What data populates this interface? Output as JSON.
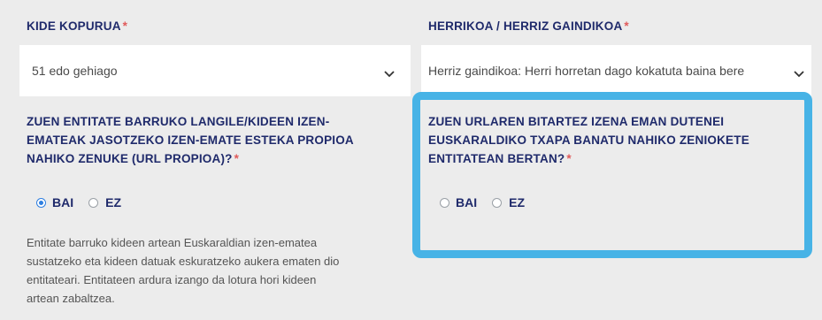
{
  "left": {
    "field_label": "KIDE KOPURUA",
    "required_mark": "*",
    "select_value": "51 edo gehiago",
    "question": [
      "ZUEN ENTITATE BARRUKO LANGILE/KIDEEN IZEN-",
      "EMATEAK JASOTZEKO IZEN-EMATE ESTEKA PROPIOA",
      "NAHIKO ZENUKE (URL PROPIOA)?"
    ],
    "option_yes": "BAI",
    "option_no": "EZ",
    "selected": "BAI",
    "help_lines": [
      "Entitate barruko kideen artean Euskaraldian izen-ematea",
      "sustatzeko eta kideen datuak eskuratzeko aukera ematen dio",
      "entitateari. Entitateen ardura izango da lotura hori kideen",
      "artean zabaltzea."
    ]
  },
  "right": {
    "field_label": "HERRIKOA / HERRIZ GAINDIKOA",
    "required_mark": "*",
    "select_value": "Herriz gaindikoa: Herri horretan dago kokatuta baina bere",
    "question": [
      "ZUEN URLAREN BITARTEZ IZENA EMAN DUTENEI",
      "EUSKARALDIKO TXAPA BANATU NAHIKO ZENIOKETE",
      "ENTITATEAN BERTAN?"
    ],
    "option_yes": "BAI",
    "option_no": "EZ",
    "selected": null
  },
  "colors": {
    "highlight_border": "#47b3e6",
    "label": "#1f2a6b",
    "required": "#e05a5a",
    "radio_selected": "#2f7fe0"
  },
  "icons": {
    "select_arrow": "chevron-down-icon"
  }
}
